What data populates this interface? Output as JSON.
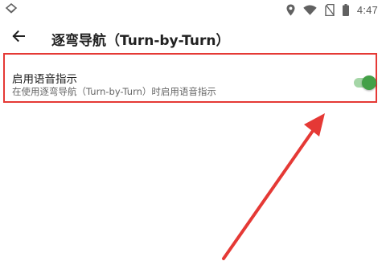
{
  "status_bar": {
    "time": "4:47",
    "icons": [
      "app-notification-icon",
      "location-icon",
      "wifi-icon",
      "no-sim-icon",
      "battery-icon"
    ]
  },
  "app_bar": {
    "back_icon": "arrow-back-icon",
    "title": "逐弯导航（Turn-by-Turn）"
  },
  "settings": {
    "voice_guidance": {
      "title": "启用语音指示",
      "subtitle": "在使用逐弯导航（Turn-by-Turn）时启用语音指示",
      "enabled": true
    }
  },
  "colors": {
    "highlight": "#e53935",
    "toggle_on": "#43a047",
    "arrow": "#e53935"
  }
}
